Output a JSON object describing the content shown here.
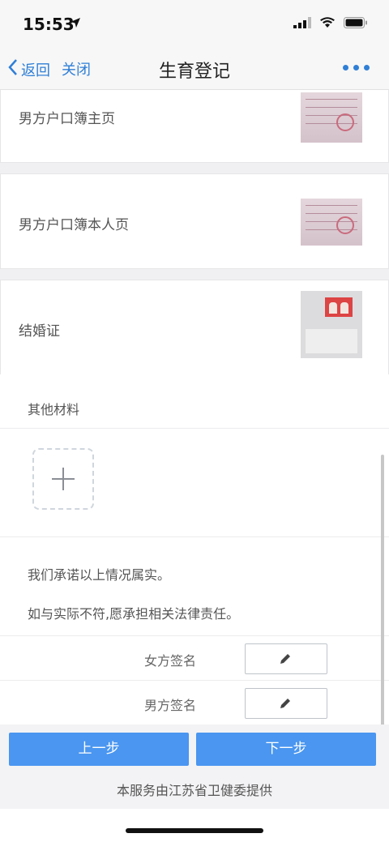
{
  "status": {
    "time": "15:53"
  },
  "nav": {
    "back_label": "返回",
    "close_label": "关闭",
    "title": "生育登记"
  },
  "documents": [
    {
      "label": "男方户口簿主页",
      "thumb": "household-register-photo"
    },
    {
      "label": "男方户口簿本人页",
      "thumb": "household-register-photo"
    },
    {
      "label": "结婚证",
      "thumb": "marriage-certificate-photo"
    }
  ],
  "other_materials": {
    "title": "其他材料"
  },
  "pledge": {
    "line1": "我们承诺以上情况属实。",
    "line2": "如与实际不符,愿承担相关法律责任。"
  },
  "signatures": {
    "female_label": "女方签名",
    "male_label": "男方签名",
    "icon": "pencil-icon"
  },
  "footer": {
    "prev_label": "上一步",
    "next_label": "下一步",
    "provider_text": "本服务由江苏省卫健委提供"
  },
  "colors": {
    "accent": "#2f7fd6",
    "button": "#4a96f0"
  }
}
